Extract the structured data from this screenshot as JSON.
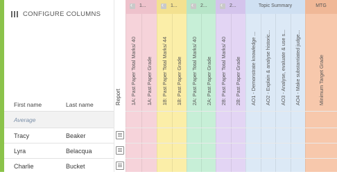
{
  "configure_label": "CONFIGURE COLUMNS",
  "headers": {
    "first_name": "First name",
    "last_name": "Last name",
    "report": "Report"
  },
  "average_label": "Average",
  "students": [
    {
      "first": "Tracy",
      "last": "Beaker"
    },
    {
      "first": "Lyra",
      "last": "Belacqua"
    },
    {
      "first": "Charlie",
      "last": "Bucket"
    }
  ],
  "groups": [
    {
      "label": "1...",
      "color": "#f6d3da",
      "header": "#eec2cc"
    },
    {
      "label": "1...",
      "color": "#fbeea8",
      "header": "#f3e190"
    },
    {
      "label": "2...",
      "color": "#c7efd7",
      "header": "#b7e5c8"
    },
    {
      "label": "2...",
      "color": "#e3d5f4",
      "header": "#d4c4ec"
    },
    {
      "label": "Topic Summary",
      "color": "#dce9f6",
      "header": "#cfe0f2"
    },
    {
      "label": "MTG",
      "color": "#f7c8ac",
      "header": "#f0b897"
    }
  ],
  "columns": [
    "1A: Past Paper Total Marks/ 40",
    "1A: Past Paper Grade",
    "1B: Past Paper Total Marks/ 44",
    "1B: Past Paper Grade",
    "2A: Past Paper Total Marks/ 40",
    "2A: Past Paper Grade",
    "2B: Past Paper Total Marks/ 40",
    "2B: Past Paper Grade",
    "AO1 - Demonstrate knowledge ...",
    "AO2 - Explain & analyse historic...",
    "AO3 - Analyse, evaluate & use s...",
    "AO4 - Make substantiated judge...",
    "Minimum Target Grade"
  ]
}
